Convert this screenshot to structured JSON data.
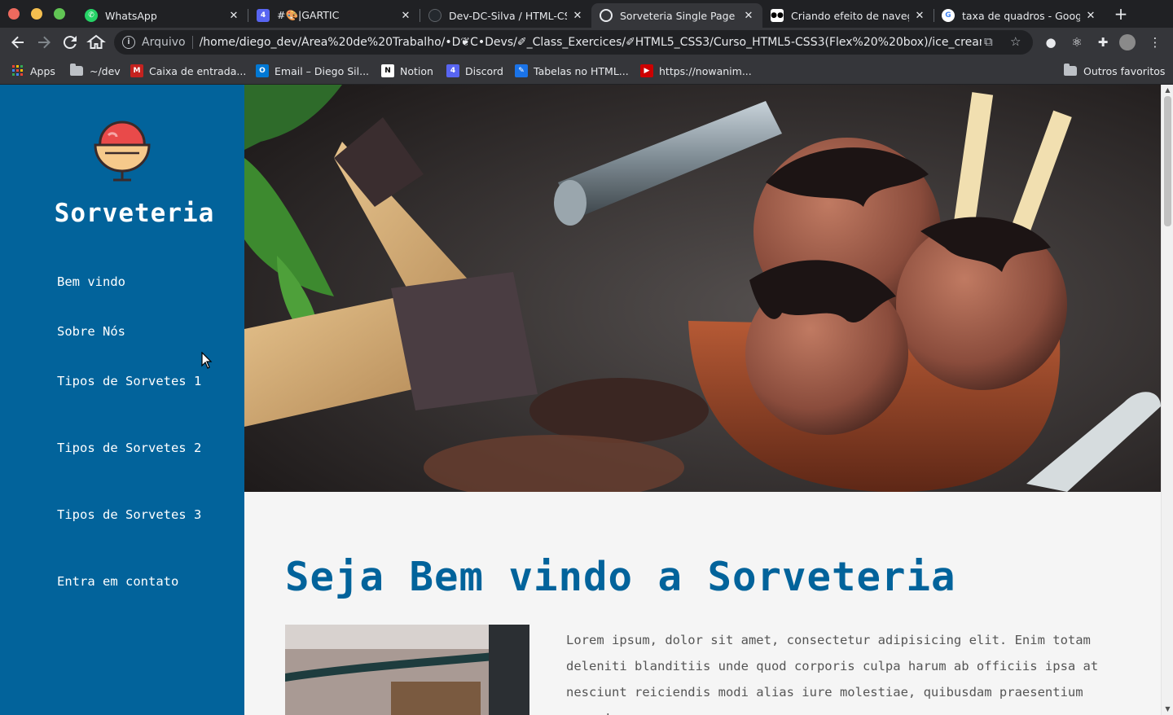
{
  "browser": {
    "tabs": [
      {
        "title": "WhatsApp",
        "favicon": "whatsapp-icon",
        "color": "#25d366"
      },
      {
        "title": "#🎨|GARTIC",
        "favicon": "discord-notification-icon",
        "color": "#5865f2"
      },
      {
        "title": "Dev-DC-Silva / HTML-CSS",
        "favicon": "github-icon",
        "color": "#24292e"
      },
      {
        "title": "Sorveteria Single Page",
        "favicon": "globe-icon",
        "color": "#9aa0a6",
        "active": true
      },
      {
        "title": "Criando efeito de navega",
        "favicon": "medium-icon",
        "color": "#000000"
      },
      {
        "title": "taxa de quadros - Google",
        "favicon": "google-icon",
        "color": "#4285f4"
      }
    ],
    "close_glyph": "✕",
    "new_tab_glyph": "+",
    "omnibox": {
      "label": "Arquivo",
      "url": "/home/diego_dev/Área%20de%20Trabalho/•D❦C•Devs/✐_Class_Exercices/✐HTML5_CSS3/Curso_HTML5-CSS3(Flex%20%20box)/ice_cream_shop/in..."
    },
    "bookmarks": [
      {
        "label": "Apps",
        "icon": "apps-grid-icon"
      },
      {
        "label": "~/dev",
        "icon": "folder-icon"
      },
      {
        "label": "Caixa de entrada...",
        "icon": "gmail-icon"
      },
      {
        "label": "Email – Diego Sil...",
        "icon": "outlook-icon"
      },
      {
        "label": "Notion",
        "icon": "notion-icon"
      },
      {
        "label": "Discord",
        "icon": "discord-icon"
      },
      {
        "label": "Tabelas no HTML...",
        "icon": "bookmark-site-icon"
      },
      {
        "label": "https://nowanim...",
        "icon": "youtube-icon"
      },
      {
        "label": "Outros favoritos",
        "icon": "folder-icon"
      }
    ]
  },
  "page": {
    "brand": "Sorveteria",
    "nav": [
      {
        "label": "Bem vindo"
      },
      {
        "label": "Sobre Nós"
      },
      {
        "label": "Tipos de Sorvetes 1"
      },
      {
        "label": "Tipos de Sorvetes 2"
      },
      {
        "label": "Tipos de Sorvetes 3"
      },
      {
        "label": "Entra em contato"
      }
    ],
    "title": "Seja Bem vindo a Sorveteria",
    "paragraph": "Lorem ipsum, dolor sit amet, consectetur adipisicing elit. Enim totam deleniti blanditiis unde quod corporis culpa harum ab officiis ipsa at nesciunt reiciendis modi alias iure molestiae, quibusdam praesentium error!",
    "colors": {
      "sidebar": "#02639b",
      "accent": "#02639b",
      "text": "#555555"
    }
  }
}
